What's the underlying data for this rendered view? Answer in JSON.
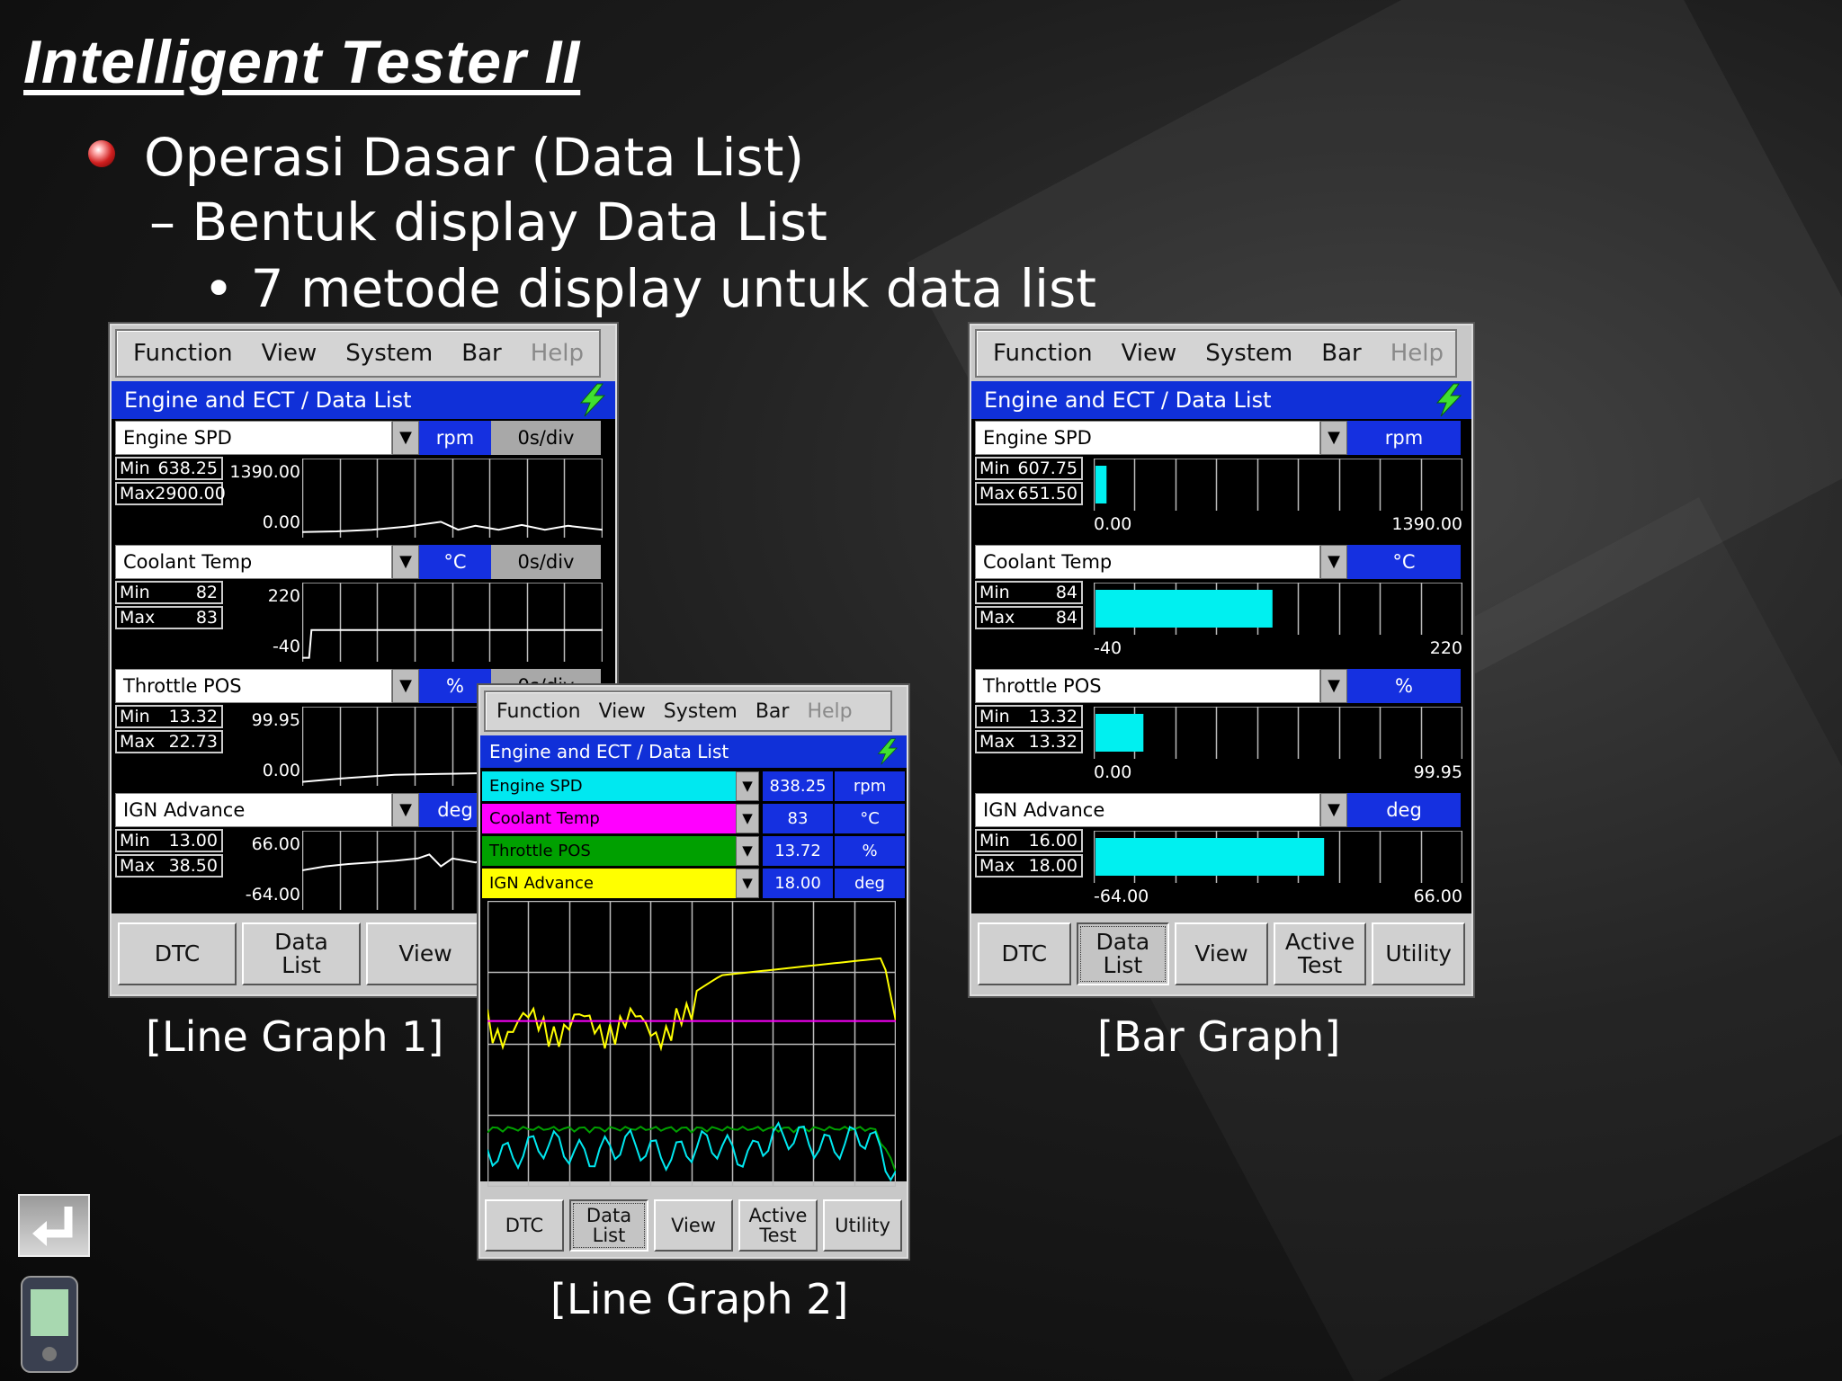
{
  "slide": {
    "title": "Intelligent Tester II",
    "line1": "Operasi Dasar (Data List)",
    "line2": "– Bentuk display Data List",
    "line3": "• 7 metode display untuk data list"
  },
  "menu": {
    "function": "Function",
    "view": "View",
    "system": "System",
    "bar": "Bar",
    "help": "Help"
  },
  "screen_title": "Engine and ECT / Data List",
  "buttons": {
    "dtc": "DTC",
    "data_list": "Data\nList",
    "view": "View",
    "active_test": "Active\nTest",
    "utility": "Utility"
  },
  "captions": {
    "line1": "[Line Graph 1]",
    "line2": "[Line Graph 2]",
    "bar": "[Bar Graph]"
  },
  "line_graph_1": {
    "channels": [
      {
        "name": "Engine SPD",
        "unit": "rpm",
        "div": "0s/div",
        "min_label": "Min",
        "min": "638.25",
        "max_label": "Max",
        "max": "2900.00",
        "scale_top": "1390.00",
        "scale_bottom": "0.00"
      },
      {
        "name": "Coolant Temp",
        "unit": "°C",
        "div": "0s/div",
        "min_label": "Min",
        "min": "82",
        "max_label": "Max",
        "max": "83",
        "scale_top": "220",
        "scale_bottom": "-40"
      },
      {
        "name": "Throttle POS",
        "unit": "%",
        "div": "0s/div",
        "min_label": "Min",
        "min": "13.32",
        "max_label": "Max",
        "max": "22.73",
        "scale_top": "99.95",
        "scale_bottom": "0.00"
      },
      {
        "name": "IGN Advance",
        "unit": "deg",
        "div": "",
        "min_label": "Min",
        "min": "13.00",
        "max_label": "Max",
        "max": "38.50",
        "scale_top": "66.00",
        "scale_bottom": "-64.00"
      }
    ]
  },
  "line_graph_2": {
    "channels": [
      {
        "name": "Engine SPD",
        "value": "838.25",
        "unit": "rpm",
        "color": "#00e8f0"
      },
      {
        "name": "Coolant Temp",
        "value": "83",
        "unit": "°C",
        "color": "#ff00ff"
      },
      {
        "name": "Throttle POS",
        "value": "13.72",
        "unit": "%",
        "color": "#00a000"
      },
      {
        "name": "IGN Advance",
        "value": "18.00",
        "unit": "deg",
        "color": "#ffff00"
      }
    ]
  },
  "bar_graph": {
    "channels": [
      {
        "name": "Engine SPD",
        "unit": "rpm",
        "min_label": "Min",
        "min": "607.75",
        "max_label": "Max",
        "max": "651.50",
        "scale_low": "0.00",
        "scale_high": "1390.00",
        "fill_fraction": 0.03
      },
      {
        "name": "Coolant Temp",
        "unit": "°C",
        "min_label": "Min",
        "min": "84",
        "max_label": "Max",
        "max": "84",
        "scale_low": "-40",
        "scale_high": "220",
        "fill_fraction": 0.48
      },
      {
        "name": "Throttle POS",
        "unit": "%",
        "min_label": "Min",
        "min": "13.32",
        "max_label": "Max",
        "max": "13.32",
        "scale_low": "0.00",
        "scale_high": "99.95",
        "fill_fraction": 0.13
      },
      {
        "name": "IGN Advance",
        "unit": "deg",
        "min_label": "Min",
        "min": "16.00",
        "max_label": "Max",
        "max": "18.00",
        "scale_low": "-64.00",
        "scale_high": "66.00",
        "fill_fraction": 0.62
      }
    ]
  },
  "colors": {
    "title_bar": "#1030d8",
    "graph_line": "#ffffff",
    "bar_fill": "#00f0f0",
    "bullet": "#d02020"
  },
  "icons": {
    "return": "return-arrow-icon",
    "device": "handheld-tester-icon",
    "bolt": "lightning-bolt-icon",
    "dropdown": "dropdown-arrow-icon"
  }
}
